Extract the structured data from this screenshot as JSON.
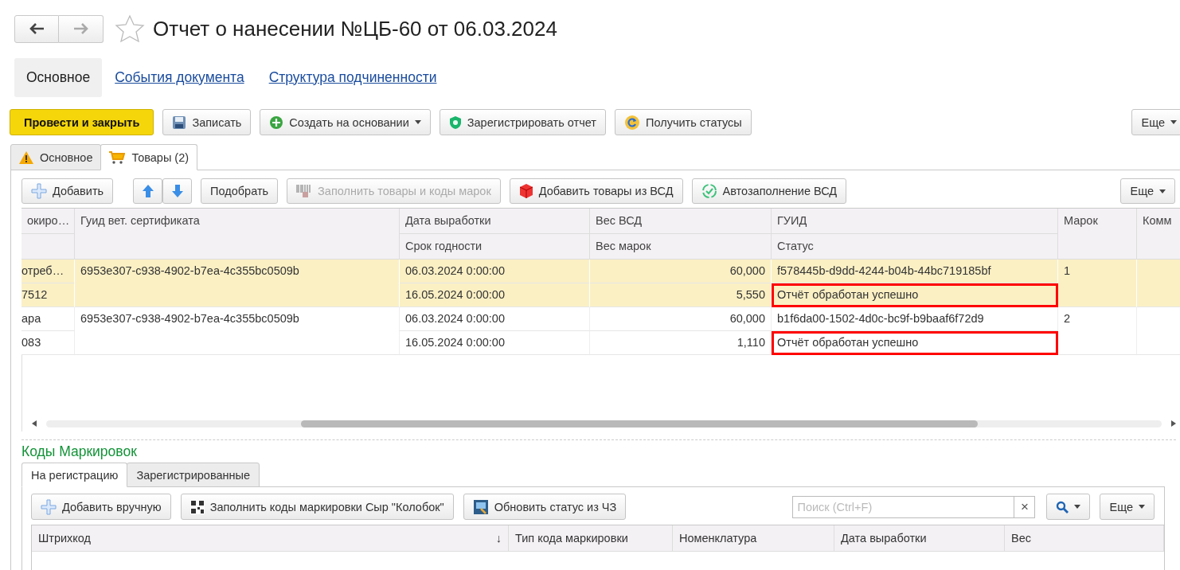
{
  "window": {
    "title": "Отчет о нанесении №ЦБ-60 от 06.03.2024",
    "favorite": false
  },
  "nav_links": [
    {
      "label": "Основное",
      "selected": true
    },
    {
      "label": "События документа",
      "selected": false
    },
    {
      "label": "Структура подчиненности",
      "selected": false
    }
  ],
  "toolbar": [
    {
      "label": "Провести и закрыть",
      "kind": "primary"
    },
    {
      "label": "Записать",
      "kind": "save"
    },
    {
      "label": "Создать на основании",
      "kind": "create"
    },
    {
      "label": "Зарегистрировать отчет",
      "kind": "shield"
    },
    {
      "label": "Получить статусы",
      "kind": "refresh"
    }
  ],
  "toolbar_more": "Еще",
  "tabs": [
    {
      "label": "Основное",
      "kind": "warning",
      "selected": false
    },
    {
      "label": "Товары (2)",
      "kind": "cart",
      "selected": true
    }
  ],
  "goods_toolbar": [
    {
      "label": "Добавить",
      "kind": "add",
      "disabled": false
    },
    {
      "kind": "updown"
    },
    {
      "label": "Подобрать",
      "kind": "plain",
      "disabled": false
    },
    {
      "label": "Заполнить товары и коды марок",
      "kind": "barcode",
      "disabled": true
    },
    {
      "label": "Добавить товары из ВСД",
      "kind": "box",
      "disabled": false
    },
    {
      "label": "Автозаполнение ВСД",
      "kind": "auto",
      "disabled": false
    }
  ],
  "goods_more": "Еще",
  "table": {
    "columns": [
      {
        "top": "окиро…"
      },
      {
        "top": "Гуид вет. сертификата"
      },
      {
        "top": "Дата выработки",
        "bottom": "Срок годности"
      },
      {
        "top": "Вес ВСД",
        "bottom": "Вес марок"
      },
      {
        "top": "ГУИД",
        "bottom": "Статус"
      },
      {
        "top": "Марок"
      },
      {
        "top": "Комм"
      }
    ],
    "rows": [
      {
        "selected": true,
        "column_1": "отреб…",
        "column_1b": "7512",
        "vet_guid": "6953e307-c938-4902-b7ea-4c355bc0509b",
        "production_date": "06.03.2024 0:00:00",
        "expiry_date": "16.05.2024 0:00:00",
        "vsd_weight": "60,000",
        "marks_weight": "5,550",
        "guid": "f578445b-d9dd-4244-b04b-44bc719185bf",
        "status": "Отчёт обработан успешно",
        "status_outlined": true,
        "marks": "1"
      },
      {
        "selected": false,
        "column_1": "ара",
        "column_1b": "083",
        "vet_guid": "6953e307-c938-4902-b7ea-4c355bc0509b",
        "production_date": "06.03.2024 0:00:00",
        "expiry_date": "16.05.2024 0:00:00",
        "vsd_weight": "60,000",
        "marks_weight": "1,110",
        "guid": "b1f6da00-1502-4d0c-bc9f-b9baaf6f72d9",
        "status": "Отчёт обработан успешно",
        "status_outlined": true,
        "marks": "2"
      }
    ]
  },
  "codes": {
    "title": "Коды Маркировок",
    "tabs": [
      {
        "label": "На регистрацию",
        "selected": true
      },
      {
        "label": "Зарегистрированные",
        "selected": false
      }
    ],
    "toolbar": [
      {
        "label": "Добавить вручную",
        "kind": "add"
      },
      {
        "label": "Заполнить коды маркировки Сыр \"Колобок\"",
        "kind": "qr"
      },
      {
        "label": "Обновить статус из ЧЗ",
        "kind": "scan"
      }
    ],
    "search": {
      "placeholder": "Поиск (Ctrl+F)",
      "clear": "×"
    },
    "more": "Еще",
    "columns": [
      {
        "label": "Штрихкод",
        "sort": "↓"
      },
      {
        "label": "Тип кода маркировки"
      },
      {
        "label": "Номенклатура"
      },
      {
        "label": "Дата выработки"
      },
      {
        "label": "Вес"
      }
    ]
  }
}
